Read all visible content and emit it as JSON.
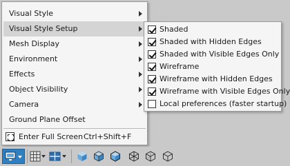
{
  "main_menu": {
    "items": [
      {
        "label": "Visual Style",
        "submenu": true
      },
      {
        "label": "Visual Style Setup",
        "submenu": true,
        "active": true
      },
      {
        "label": "Mesh Display",
        "submenu": true
      },
      {
        "label": "Environment",
        "submenu": true
      },
      {
        "label": "Effects",
        "submenu": true
      },
      {
        "label": "Object Visibility",
        "submenu": true
      },
      {
        "label": "Camera",
        "submenu": true
      },
      {
        "label": "Ground Plane Offset",
        "submenu": false
      }
    ],
    "full_screen": {
      "label": "Enter Full Screen",
      "shortcut": "Ctrl+Shift+F",
      "icon": "fullscreen-icon"
    }
  },
  "visual_style_setup_submenu": {
    "items": [
      {
        "label": "Shaded",
        "checked": true
      },
      {
        "label": "Shaded with Hidden Edges",
        "checked": true
      },
      {
        "label": "Shaded with Visible Edges Only",
        "checked": true
      },
      {
        "label": "Wireframe",
        "checked": true
      },
      {
        "label": "Wireframe with Hidden Edges",
        "checked": true
      },
      {
        "label": "Wireframe with Visible Edges Only",
        "checked": true
      },
      {
        "label": "Local preferences (faster startup)",
        "checked": false
      }
    ]
  },
  "toolbar": {
    "buttons": [
      {
        "icon": "display-monitor-icon",
        "dropdown": true,
        "active": true
      },
      {
        "icon": "grid-icon",
        "dropdown": true
      },
      {
        "icon": "viewport-layout-icon",
        "dropdown": true
      },
      {
        "icon": "cube-shaded-icon"
      },
      {
        "icon": "cube-shaded-hidden-edges-icon"
      },
      {
        "icon": "cube-shaded-visible-edges-icon"
      },
      {
        "icon": "cube-wireframe-icon"
      },
      {
        "icon": "cube-wireframe-hidden-edges-icon"
      },
      {
        "icon": "cube-wireframe-visible-edges-icon"
      }
    ],
    "accent_color": "#2f7fc1"
  }
}
